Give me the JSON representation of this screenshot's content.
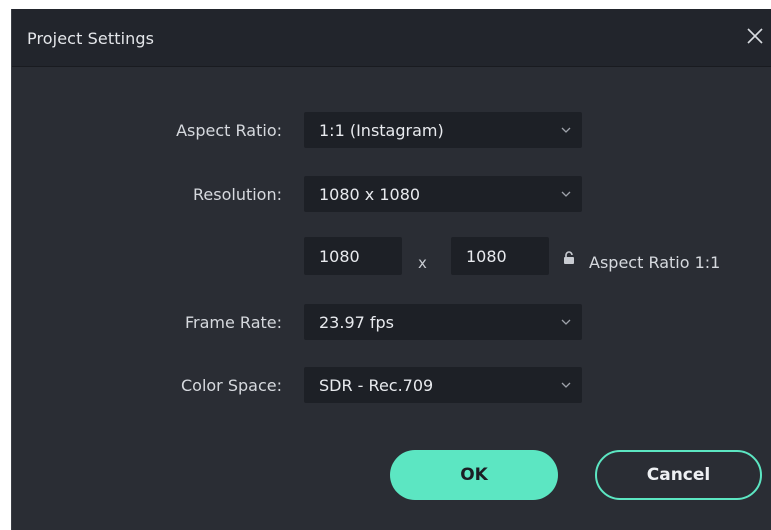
{
  "dialog": {
    "title": "Project Settings",
    "close_icon": "close-icon"
  },
  "fields": {
    "aspect_ratio": {
      "label": "Aspect Ratio:",
      "value": "1:1 (Instagram)"
    },
    "resolution": {
      "label": "Resolution:",
      "value": "1080 x 1080"
    },
    "width": "1080",
    "separator": "x",
    "height": "1080",
    "lock_icon": "lock-icon",
    "aspect_ratio_text": "Aspect Ratio  1:1",
    "frame_rate": {
      "label": "Frame Rate:",
      "value": "23.97 fps"
    },
    "color_space": {
      "label": "Color Space:",
      "value": "SDR - Rec.709"
    }
  },
  "buttons": {
    "ok": "OK",
    "cancel": "Cancel"
  },
  "colors": {
    "accent": "#5ce6c2",
    "panel": "#2a2d34",
    "titlebar": "#22252c",
    "input_bg": "#1d2026"
  }
}
